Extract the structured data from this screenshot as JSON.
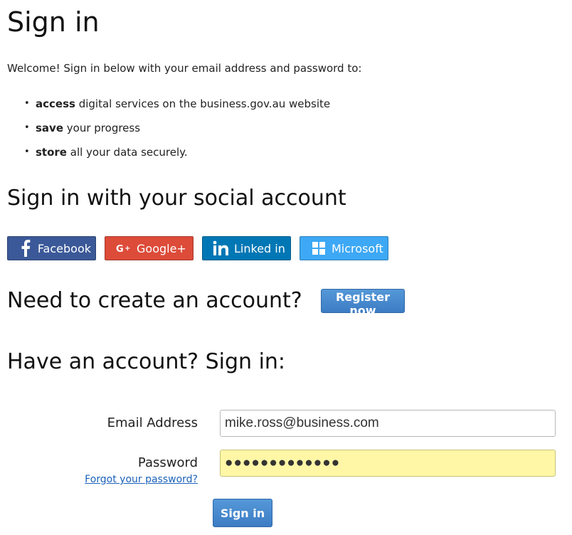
{
  "page": {
    "title": "Sign in",
    "intro": "Welcome! Sign in below with your email address and password to:",
    "bullets": [
      {
        "bold": "access",
        "rest": " digital services on the business.gov.au website"
      },
      {
        "bold": "save",
        "rest": " your progress"
      },
      {
        "bold": "store",
        "rest": " all your data securely."
      }
    ]
  },
  "social": {
    "heading": "Sign in with your social account",
    "buttons": [
      {
        "label": "Facebook",
        "icon": "facebook-icon",
        "color": "#3b5998"
      },
      {
        "label": "Google+",
        "icon": "google-plus-icon",
        "color": "#dd4b39"
      },
      {
        "label": "Linked in",
        "icon": "linkedin-icon",
        "color": "#0077b5"
      },
      {
        "label": "Microsoft",
        "icon": "microsoft-icon",
        "color": "#3da8f5"
      }
    ]
  },
  "register": {
    "heading": "Need to create an account?",
    "button_label": "Register now"
  },
  "signin_form": {
    "heading": "Have an account? Sign in:",
    "email_label": "Email Address",
    "email_value": "mike.ross@business.com",
    "password_label": "Password",
    "password_value": "●●●●●●●●●●●●●",
    "forgot_link": "Forgot your password?",
    "submit_label": "Sign in"
  },
  "colors": {
    "primary_button": "#3c7cc4",
    "password_autofill_bg": "#fff7a6",
    "link": "#1a62b8"
  }
}
